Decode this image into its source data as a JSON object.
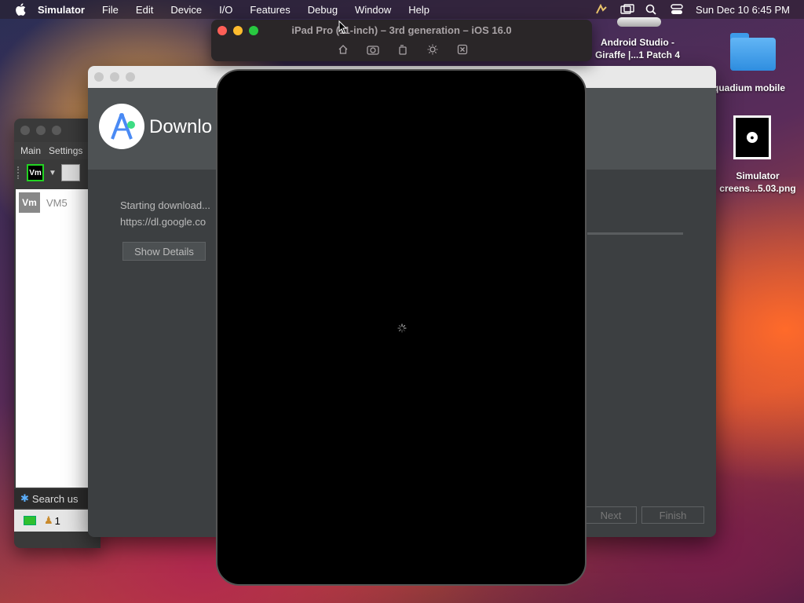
{
  "menubar": {
    "app_name": "Simulator",
    "items": [
      "File",
      "Edit",
      "Device",
      "I/O",
      "Features",
      "Debug",
      "Window",
      "Help"
    ],
    "clock": "Sun Dec 10  6:45 PM"
  },
  "desktop": {
    "android_studio_label": "Android Studio -\nGiraffe |...1 Patch 4",
    "folder_label": "quadium mobile",
    "screenshot_label": "Simulator\ncreens...5.03.png"
  },
  "simulator": {
    "title": "iPad Pro (11-inch) – 3rd generation – iOS 16.0",
    "tools": [
      "home-icon",
      "screenshot-icon",
      "rotate-icon",
      "brightness-icon",
      "close-icon"
    ]
  },
  "vm_window": {
    "menus": [
      "Main",
      "Settings"
    ],
    "vm_badge": "Vm",
    "vm_name": "VM5",
    "search_placeholder": "Search us",
    "user_count": "1"
  },
  "android_studio": {
    "heading": "Downlo",
    "status": "Starting download...",
    "url": "https://dl.google.co",
    "show_details": "Show Details",
    "next": "Next",
    "finish": "Finish"
  }
}
